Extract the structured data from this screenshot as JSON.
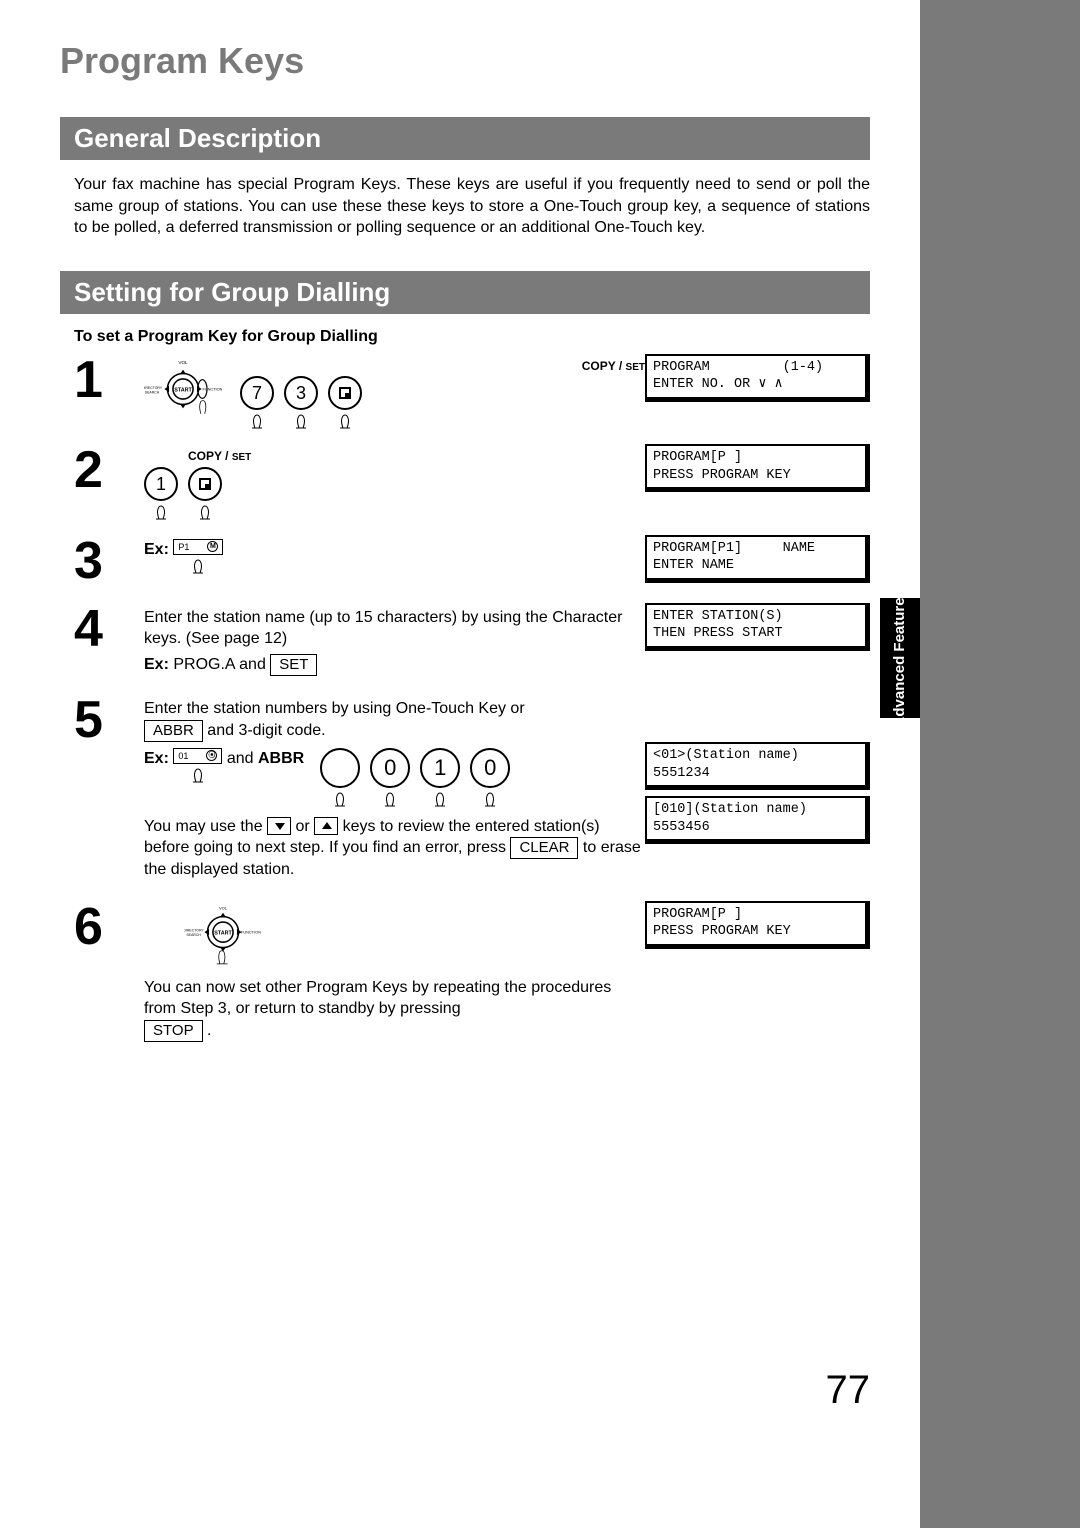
{
  "title": "Program Keys",
  "side_tab": "Advanced\nFeatures",
  "page_number": "77",
  "section1": {
    "heading": "General Description",
    "body": "Your fax machine has special Program Keys.  These keys are useful if you frequently need to send or poll the same group of stations.  You can use these these keys to store a One-Touch group key, a sequence of stations to be polled, a deferred transmission or polling sequence or an additional One-Touch key."
  },
  "section2": {
    "heading": "Setting for Group Dialling",
    "subhead": "To set a Program Key for Group Dialling"
  },
  "labels": {
    "copy": "COPY",
    "set": "SET",
    "ex": "Ex:",
    "abbr": "ABBR",
    "abbr_bold": "ABBR",
    "clear": "CLEAR",
    "stop": "STOP",
    "set_key": "SET",
    "start": "START",
    "function": "FUNCTION",
    "dir_search": "DIRECTORY\nSEARCH",
    "vol": "VOL",
    "p1": "P1",
    "m": "M",
    "one": "01",
    "and": " and ",
    "and3": " and 3-digit code.",
    "or": " or "
  },
  "keys": {
    "k7": "7",
    "k3": "3",
    "k1": "1",
    "k0a": "0",
    "k1a": "1",
    "k0b": "0"
  },
  "steps": {
    "s1": "1",
    "s2": "2",
    "s3": "3",
    "s4": "4",
    "s5": "5",
    "s6": "6",
    "s4_text1": "Enter the station name (up to 15 characters) by using the Character keys.  (See page 12)",
    "s4_ex": "PROG.A and ",
    "s5_text1": "Enter the station numbers by using One-Touch Key or ",
    "s5_text2": "You may use the ",
    "s5_text3": " keys to review the entered station(s) before going to next step. If you find an error, press ",
    "s5_text4": " to erase the displayed station.",
    "s6_text": "You can now set other Program Keys by repeating the procedures from Step 3, or return to standby by pressing "
  },
  "lcd": {
    "l1": "PROGRAM         (1-4)\nENTER NO. OR ∨ ∧",
    "l2": "PROGRAM[P ]\nPRESS PROGRAM KEY",
    "l3": "PROGRAM[P1]     NAME\nENTER NAME",
    "l4": "ENTER STATION(S)\nTHEN PRESS START",
    "l5a": "<01>(Station name)\n5551234",
    "l5b": "[010](Station name)\n5553456",
    "l6": "PROGRAM[P ]\nPRESS PROGRAM KEY"
  }
}
